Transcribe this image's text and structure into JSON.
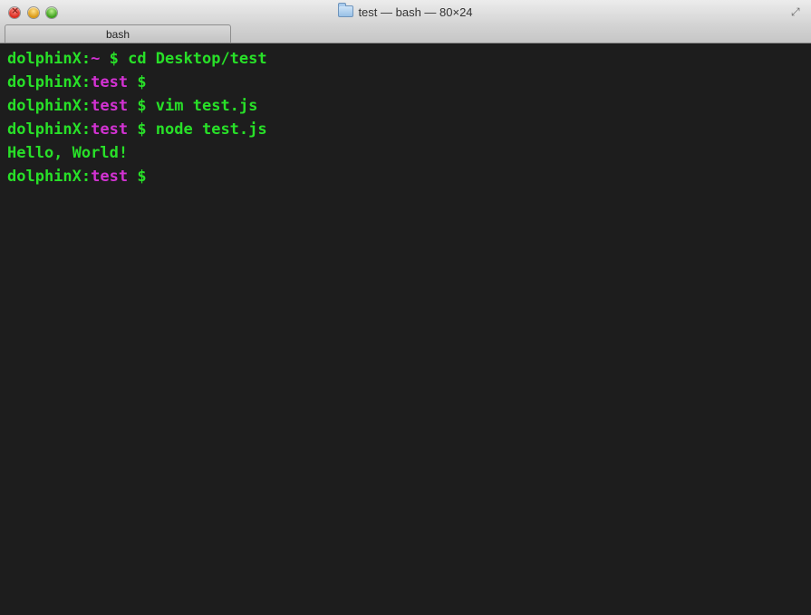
{
  "window": {
    "title": "test — bash — 80×24",
    "tab_label": "bash",
    "title_icon": "folder-icon"
  },
  "terminal": {
    "colors": {
      "prompt_user": "#28e028",
      "prompt_dir": "#d332d3",
      "text": "#28e028",
      "background": "#1d1d1d"
    },
    "lines": [
      {
        "user": "dolphinX",
        "sep": ":",
        "dir": "~",
        "cmd": " $ cd Desktop/test"
      },
      {
        "user": "dolphinX",
        "sep": ":",
        "dir": "test",
        "cmd": " $"
      },
      {
        "user": "dolphinX",
        "sep": ":",
        "dir": "test",
        "cmd": " $ vim test.js"
      },
      {
        "user": "dolphinX",
        "sep": ":",
        "dir": "test",
        "cmd": " $ node test.js"
      },
      {
        "output": "Hello, World!"
      },
      {
        "user": "dolphinX",
        "sep": ":",
        "dir": "test",
        "cmd": " $"
      }
    ]
  }
}
